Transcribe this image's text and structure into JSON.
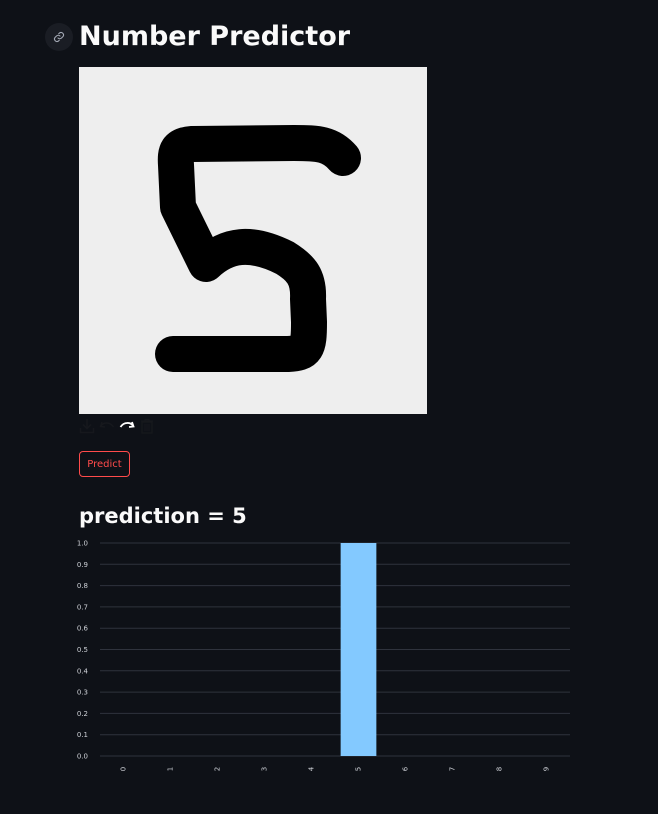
{
  "header": {
    "title": "Number Predictor"
  },
  "canvas": {
    "background": "#eeeeee",
    "stroke_color": "#000000"
  },
  "toolbar": {
    "icons": [
      "download-icon",
      "undo-icon",
      "redo-icon",
      "trash-icon"
    ]
  },
  "actions": {
    "predict_label": "Predict"
  },
  "result": {
    "prediction_text": "prediction = 5"
  },
  "colors": {
    "background": "#0e1117",
    "accent": "#ff4b4b",
    "bar": "#83c9ff",
    "grid": "#2f333d"
  },
  "chart_data": {
    "type": "bar",
    "categories": [
      "0",
      "1",
      "2",
      "3",
      "4",
      "5",
      "6",
      "7",
      "8",
      "9"
    ],
    "values": [
      0,
      0,
      0,
      0,
      0,
      1,
      0,
      0,
      0,
      0
    ],
    "ylim": [
      0,
      1
    ],
    "yticks": [
      "0.0",
      "0.1",
      "0.2",
      "0.3",
      "0.4",
      "0.5",
      "0.6",
      "0.7",
      "0.8",
      "0.9",
      "1.0"
    ],
    "grid": true
  }
}
